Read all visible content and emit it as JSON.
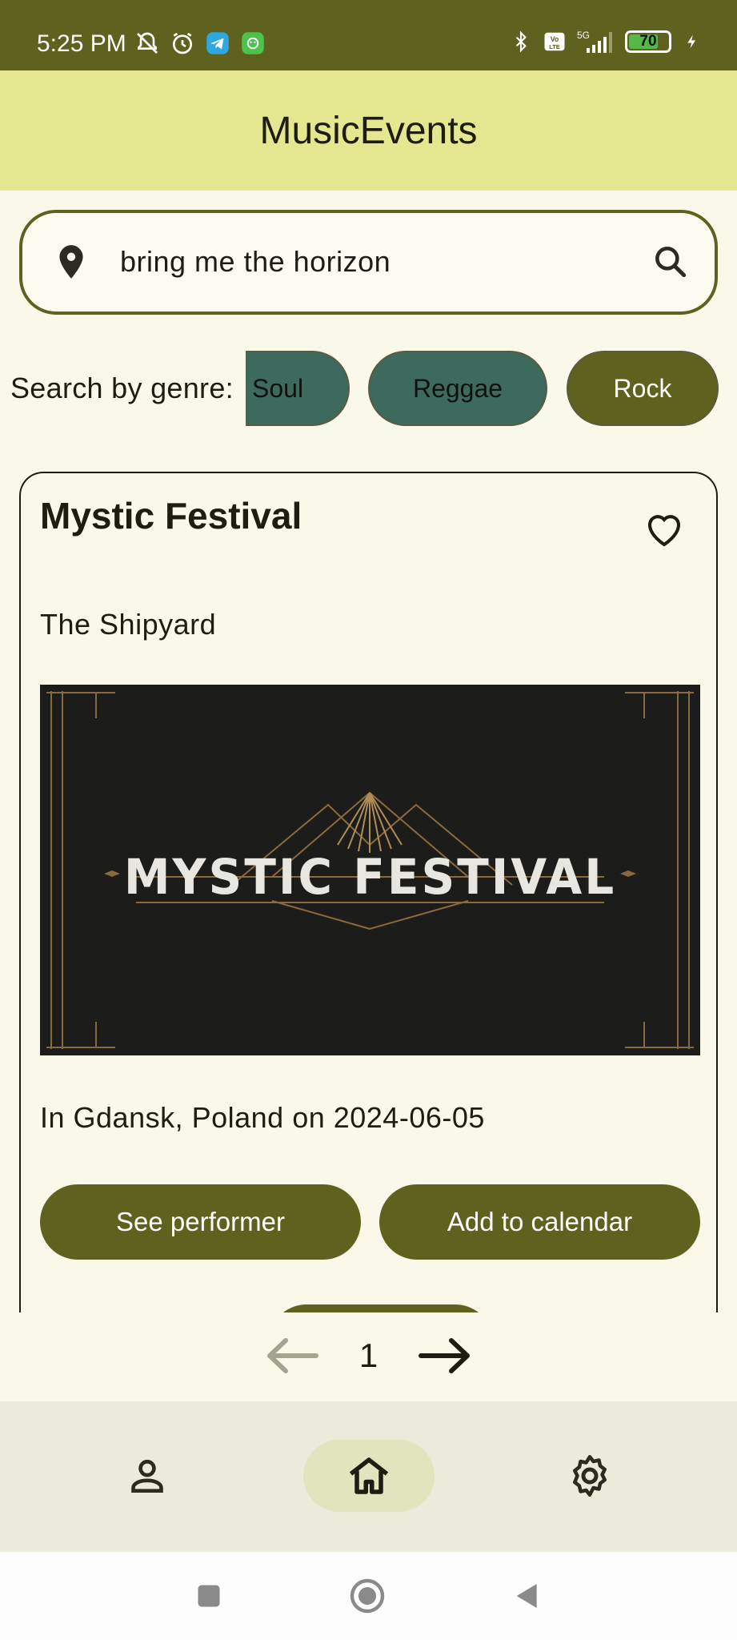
{
  "status_bar": {
    "time": "5:25 PM",
    "battery": "70",
    "icons": [
      "mute-icon",
      "alarm-icon",
      "telegram-icon",
      "app-icon",
      "bluetooth-icon",
      "volte-icon",
      "signal-5g-icon",
      "charging-icon"
    ]
  },
  "app_bar": {
    "title": "MusicEvents"
  },
  "search": {
    "value": "bring me the horizon"
  },
  "genres": {
    "label": "Search by genre:",
    "chips": [
      {
        "label": "Soul",
        "color": "#3e6a5e"
      },
      {
        "label": "Reggae",
        "color": "#3e6a5e"
      },
      {
        "label": "Rock",
        "color": "#5f611f",
        "selected": true
      }
    ]
  },
  "event": {
    "title": "Mystic Festival",
    "venue": "The Shipyard",
    "poster_text": "MYSTIC FESTIVAL",
    "info": "In Gdansk, Poland on 2024-06-05",
    "buttons": {
      "performer": "See performer",
      "calendar": "Add to calendar"
    }
  },
  "pagination": {
    "page": "1"
  },
  "nav": {
    "items": [
      "profile",
      "home",
      "settings"
    ],
    "selected": "home"
  },
  "colors": {
    "primary": "#5f611f",
    "app_bar": "#e4e690",
    "background": "#f9f8e9",
    "chip_teal": "#3e6a5e",
    "nav_selected": "#e2e4bd"
  }
}
